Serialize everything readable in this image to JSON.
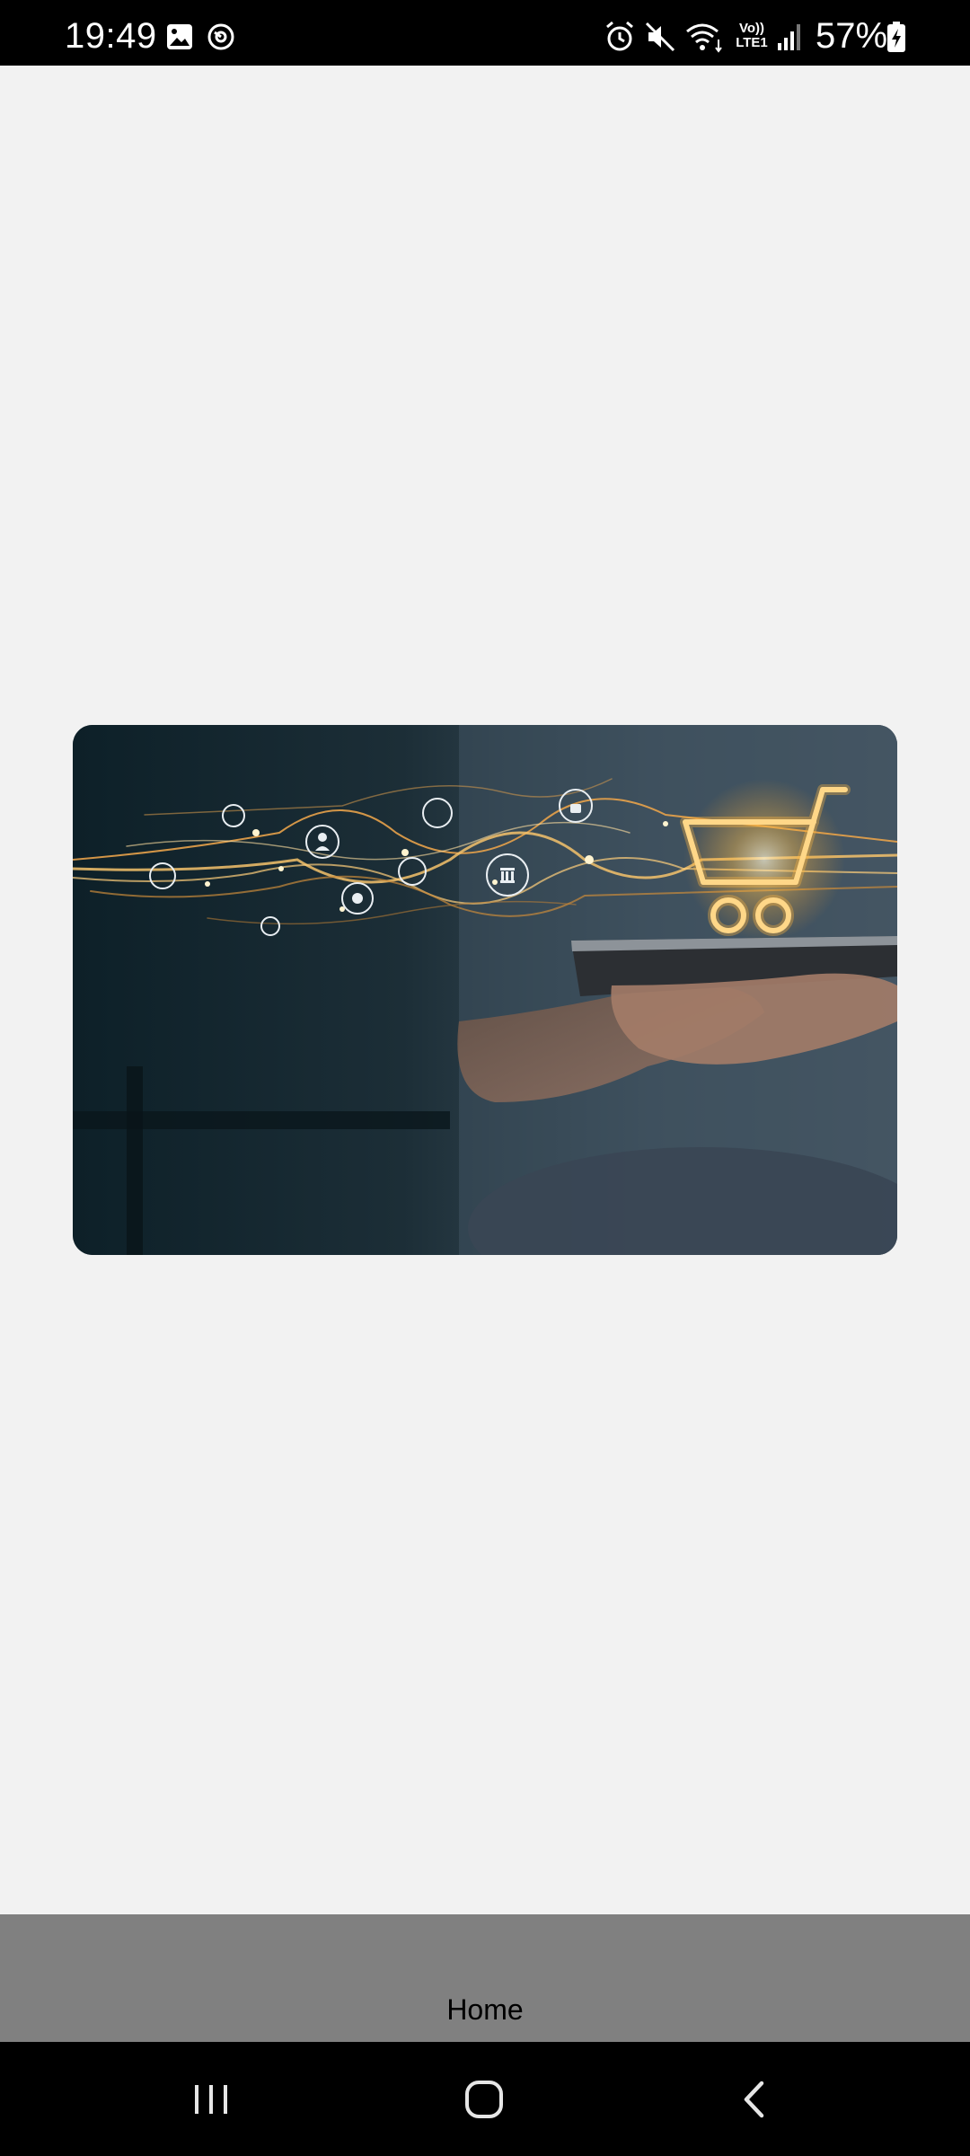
{
  "status_bar": {
    "time": "19:49",
    "volte": "Vo))\nLTE1",
    "battery": "57%"
  },
  "icons": {
    "status_left": [
      "gallery-icon",
      "sync-icon"
    ],
    "status_right": [
      "alarm-icon",
      "mute-icon",
      "wifi-icon",
      "signal-icon",
      "battery-charging-icon"
    ],
    "nav": [
      "recent-apps-icon",
      "home-icon",
      "back-icon"
    ]
  },
  "hero": {
    "subject": "e-commerce shopping cart illustration"
  },
  "bottom_bar": {
    "home_label": "Home"
  },
  "colors": {
    "status_bar_bg": "#000000",
    "page_bg": "#f2f2f2",
    "bottom_bar_bg": "#808080",
    "nav_bar_bg": "#000000"
  }
}
